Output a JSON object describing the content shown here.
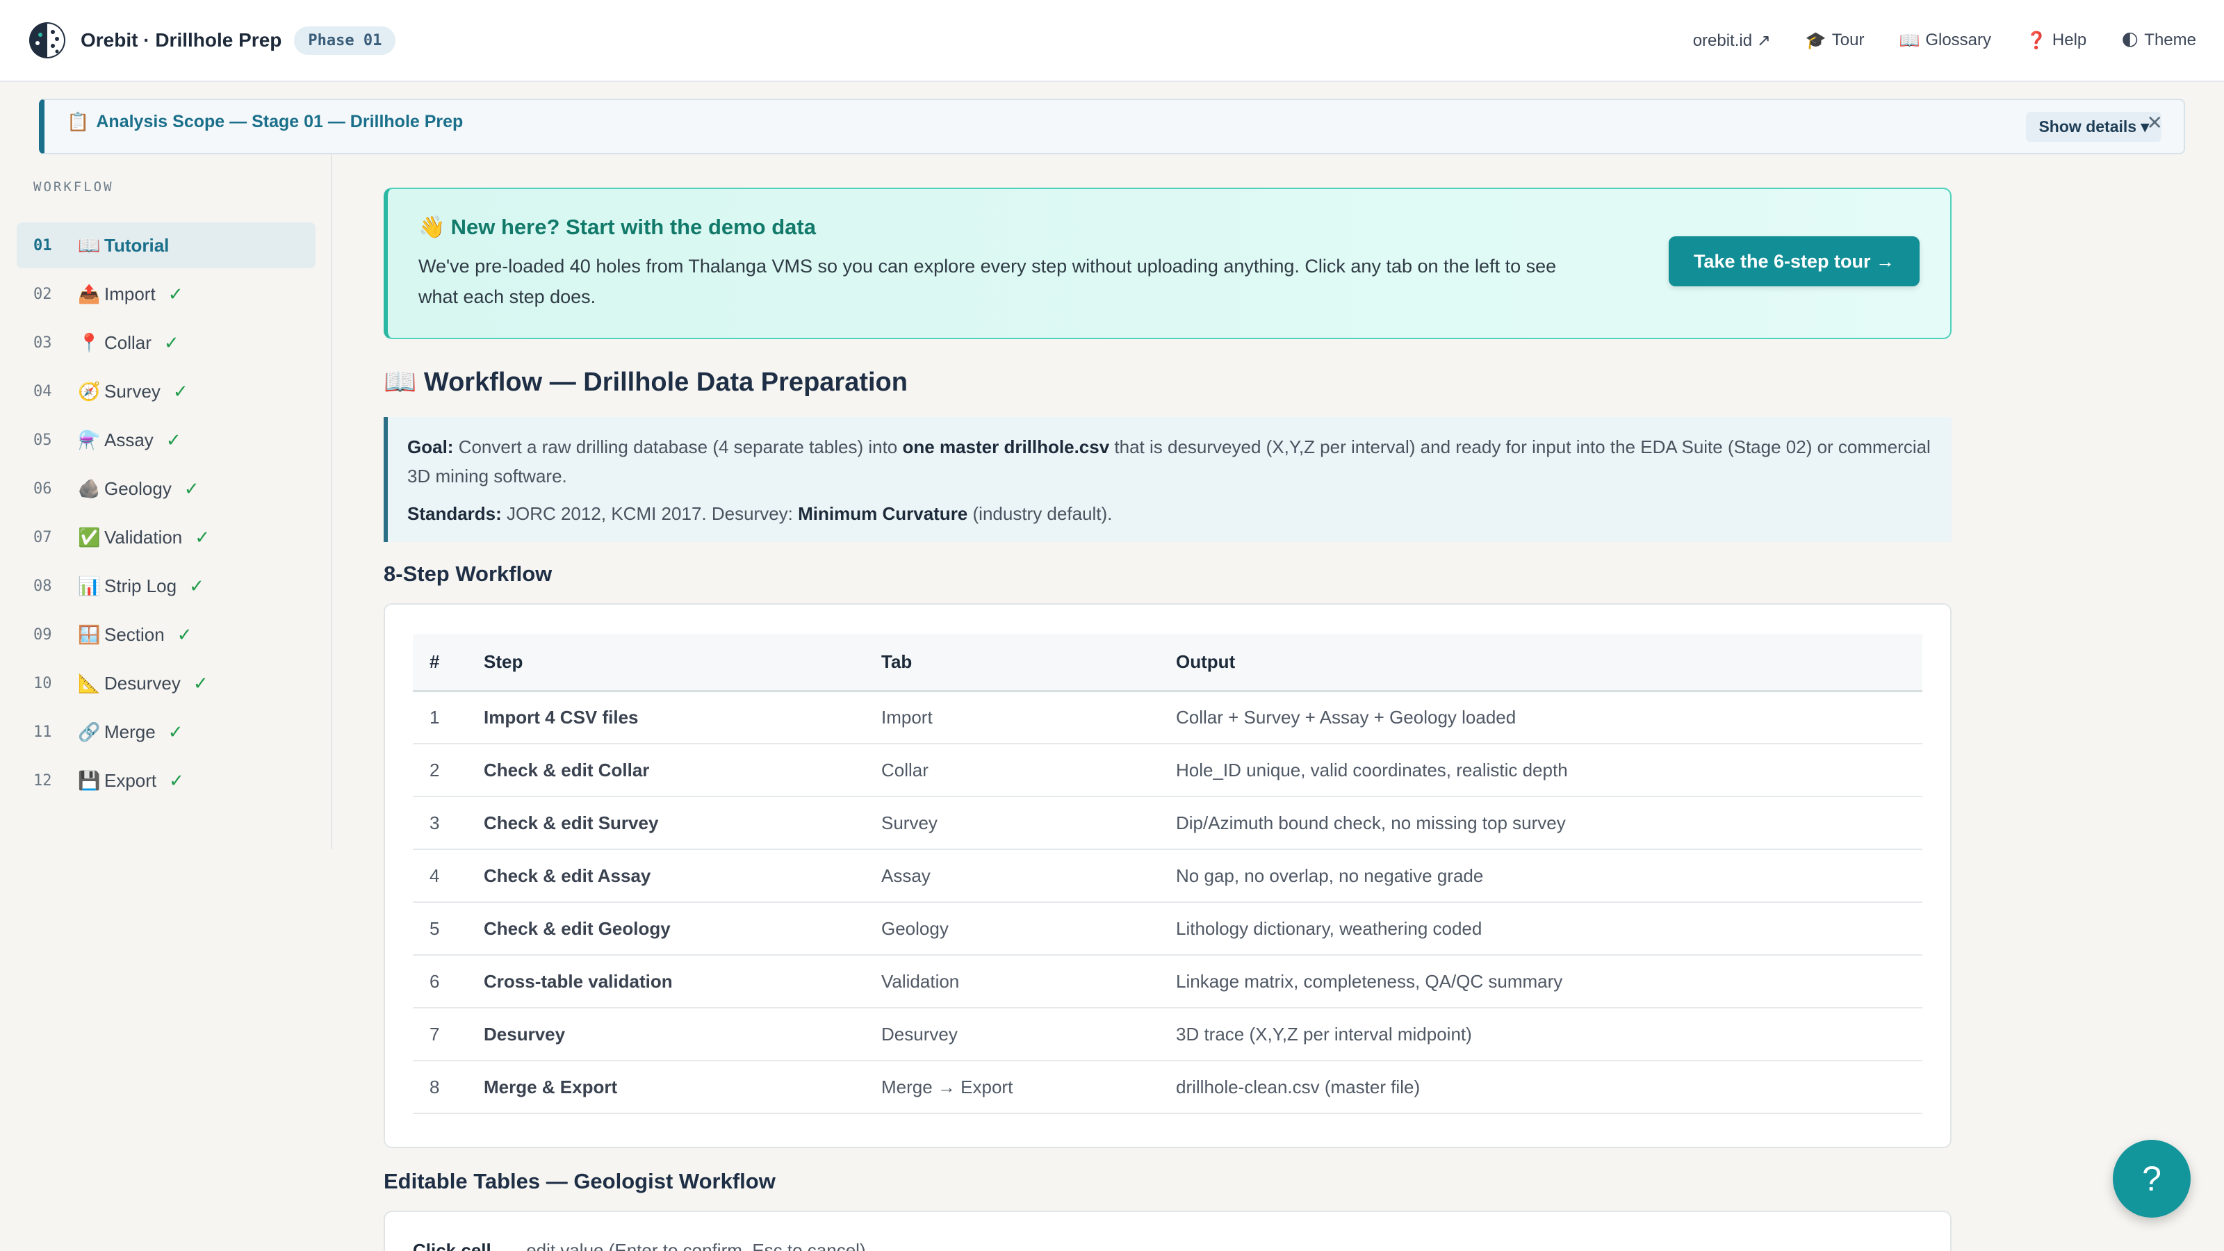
{
  "header": {
    "brand": "Orebit · Drillhole Prep",
    "phase": "Phase 01",
    "links": [
      {
        "label": "orebit.id ↗",
        "icon": ""
      },
      {
        "label": "Tour",
        "icon": "🎓"
      },
      {
        "label": "Glossary",
        "icon": "📖"
      },
      {
        "label": "Help",
        "icon": "❓"
      },
      {
        "label": "Theme",
        "icon": "🌓"
      }
    ]
  },
  "scope": {
    "icon": "📋",
    "title": "Analysis Scope — Stage 01 — Drillhole Prep",
    "show_details": "Show details ▾",
    "close": "✕"
  },
  "sidebar": {
    "heading": "WORKFLOW",
    "items": [
      {
        "num": "01",
        "icon": "📖",
        "label": "Tutorial",
        "check": ""
      },
      {
        "num": "02",
        "icon": "📤",
        "label": "Import",
        "check": "✓"
      },
      {
        "num": "03",
        "icon": "📍",
        "label": "Collar",
        "check": "✓"
      },
      {
        "num": "04",
        "icon": "🧭",
        "label": "Survey",
        "check": "✓"
      },
      {
        "num": "05",
        "icon": "⚗️",
        "label": "Assay",
        "check": "✓"
      },
      {
        "num": "06",
        "icon": "🪨",
        "label": "Geology",
        "check": "✓"
      },
      {
        "num": "07",
        "icon": "✅",
        "label": "Validation",
        "check": "✓"
      },
      {
        "num": "08",
        "icon": "📊",
        "label": "Strip Log",
        "check": "✓"
      },
      {
        "num": "09",
        "icon": "🪟",
        "label": "Section",
        "check": "✓"
      },
      {
        "num": "10",
        "icon": "📐",
        "label": "Desurvey",
        "check": "✓"
      },
      {
        "num": "11",
        "icon": "🔗",
        "label": "Merge",
        "check": "✓"
      },
      {
        "num": "12",
        "icon": "💾",
        "label": "Export",
        "check": "✓"
      }
    ]
  },
  "welcome": {
    "icon": "👋",
    "title": "New here? Start with the demo data",
    "text": "We've pre-loaded 40 holes from Thalanga VMS so you can explore every step without uploading anything. Click any tab on the left to see what each step does.",
    "button": "Take the 6-step tour →"
  },
  "workflow": {
    "icon": "📖",
    "title": "Workflow — Drillhole Data Preparation",
    "goal_label": "Goal:",
    "goal_text_1": "Convert a raw drilling database (4 separate tables) into",
    "goal_bold": "one master drillhole.csv",
    "goal_text_2": "that is desurveyed (X,Y,Z per interval) and ready for input into the EDA Suite (Stage 02) or commercial 3D mining software.",
    "standards_label": "Standards:",
    "standards_text_1": "JORC 2012, KCMI 2017. Desurvey:",
    "standards_bold": "Minimum Curvature",
    "standards_text_2": "(industry default)."
  },
  "steps_table": {
    "title": "8-Step Workflow",
    "headers": [
      "#",
      "Step",
      "Tab",
      "Output"
    ],
    "rows": [
      [
        "1",
        "Import 4 CSV files",
        "Import",
        "Collar + Survey + Assay + Geology loaded"
      ],
      [
        "2",
        "Check & edit Collar",
        "Collar",
        "Hole_ID unique, valid coordinates, realistic depth"
      ],
      [
        "3",
        "Check & edit Survey",
        "Survey",
        "Dip/Azimuth bound check, no missing top survey"
      ],
      [
        "4",
        "Check & edit Assay",
        "Assay",
        "No gap, no overlap, no negative grade"
      ],
      [
        "5",
        "Check & edit Geology",
        "Geology",
        "Lithology dictionary, weathering coded"
      ],
      [
        "6",
        "Cross-table validation",
        "Validation",
        "Linkage matrix, completeness, QA/QC summary"
      ],
      [
        "7",
        "Desurvey",
        "Desurvey",
        "3D trace (X,Y,Z per interval midpoint)"
      ],
      [
        "8",
        "Merge & Export",
        "Merge → Export",
        "drillhole-clean.csv (master file)"
      ]
    ]
  },
  "editable": {
    "title": "Editable Tables — Geologist Workflow",
    "click_label": "Click cell",
    "click_text": "→ edit value (Enter to confirm, Esc to cancel)"
  },
  "fab": {
    "label": "?"
  }
}
